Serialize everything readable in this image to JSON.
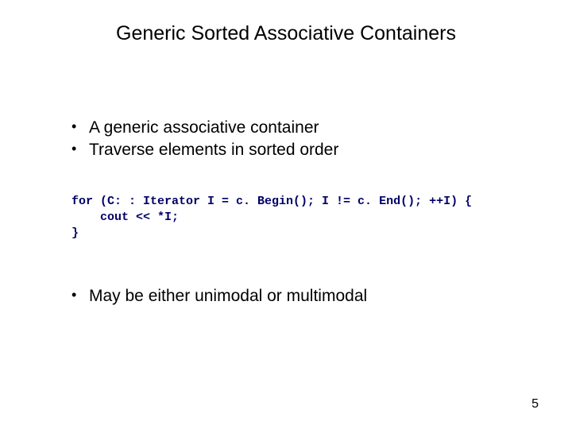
{
  "title": "Generic Sorted Associative Containers",
  "bullets1": {
    "item1": "A generic associative container",
    "item2": "Traverse elements in sorted order"
  },
  "code": {
    "line1": "for (C: : Iterator I = c. Begin(); I != c. End(); ++I) {",
    "line2": "    cout << *I;",
    "line3": "}"
  },
  "bullets2": {
    "item1": "May be either unimodal or multimodal"
  },
  "page_number": "5"
}
